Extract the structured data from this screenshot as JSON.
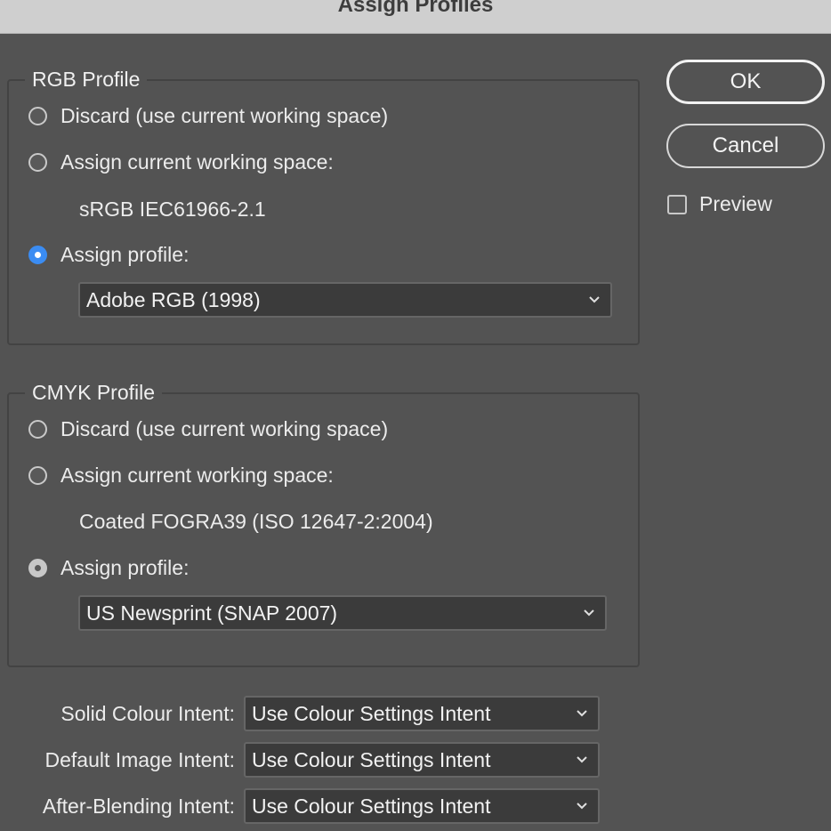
{
  "window": {
    "title": "Assign Profiles"
  },
  "rgb": {
    "legend": "RGB Profile",
    "discard_label": "Discard (use current working space)",
    "assign_current_label": "Assign current working space:",
    "current_space": "sRGB IEC61966-2.1",
    "assign_profile_label": "Assign profile:",
    "profile_value": "Adobe RGB (1998)"
  },
  "cmyk": {
    "legend": "CMYK Profile",
    "discard_label": "Discard (use current working space)",
    "assign_current_label": "Assign current working space:",
    "current_space": "Coated FOGRA39 (ISO 12647-2:2004)",
    "assign_profile_label": "Assign profile:",
    "profile_value": "US Newsprint (SNAP 2007)"
  },
  "intents": [
    {
      "label": "Solid Colour Intent:",
      "value": "Use Colour Settings Intent"
    },
    {
      "label": "Default Image Intent:",
      "value": "Use Colour Settings Intent"
    },
    {
      "label": "After-Blending Intent:",
      "value": "Use Colour Settings Intent"
    }
  ],
  "buttons": {
    "ok": "OK",
    "cancel": "Cancel"
  },
  "preview": {
    "label": "Preview",
    "checked": false
  },
  "colors": {
    "accent": "#3b8cf2",
    "background": "#535353",
    "titlebar": "#cfcfcf"
  }
}
